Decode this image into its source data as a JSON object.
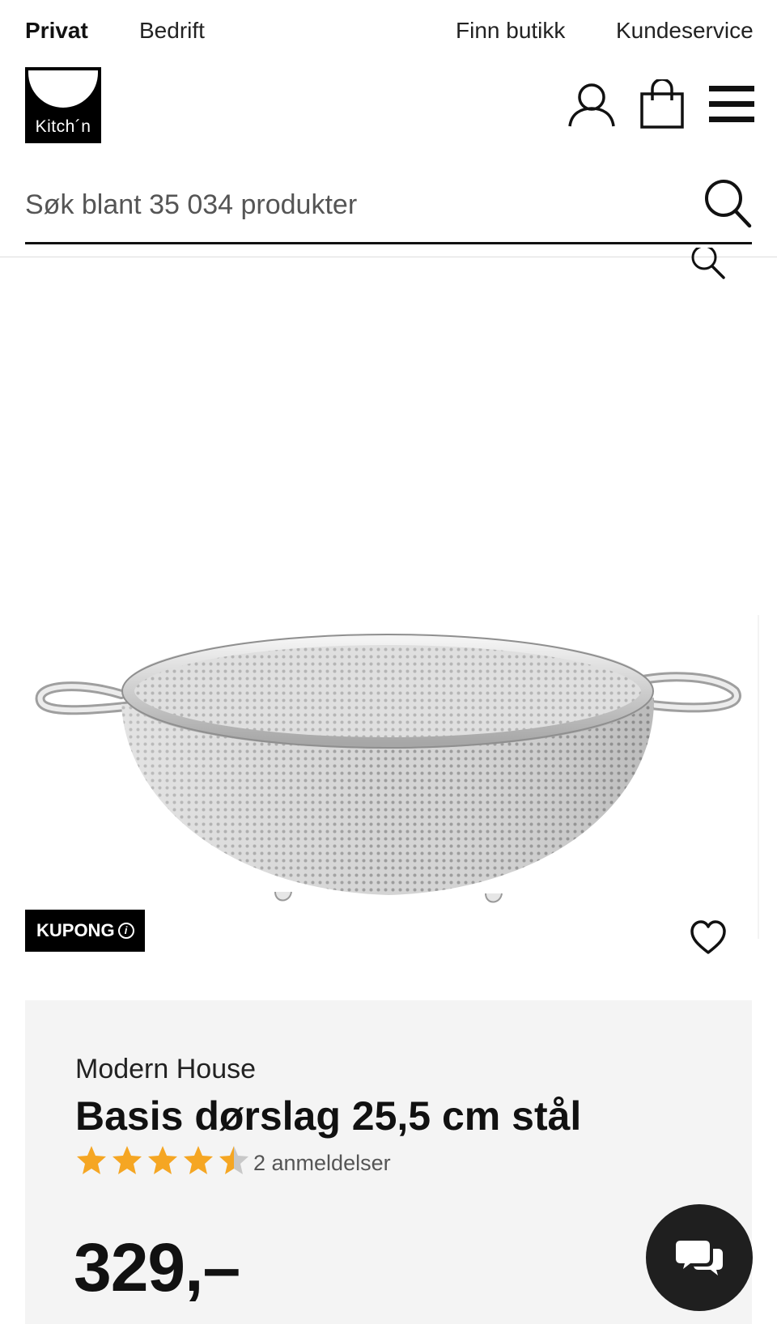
{
  "topnav": {
    "privat": "Privat",
    "bedrift": "Bedrift",
    "finn_butikk": "Finn butikk",
    "kundeservice": "Kundeservice"
  },
  "logo": {
    "text": "Kitch´n"
  },
  "header_icons": [
    "user-icon",
    "shopping-bag-icon",
    "menu-icon"
  ],
  "search": {
    "placeholder": "Søk blant 35 034 produkter",
    "icon": "search-icon"
  },
  "product": {
    "image_alt": "Stainless steel colander with two handles",
    "coupon_label": "KUPONG",
    "brand": "Modern House",
    "title": "Basis dørslag 25,5 cm stål",
    "rating": 4.5,
    "rating_max": 5,
    "reviews": "2 anmeldelser",
    "price": "329,–"
  },
  "colors": {
    "star": "#f5a623",
    "star_empty": "#c8c8c8",
    "panel": "#f4f4f4",
    "chat": "#1f1f1f"
  }
}
